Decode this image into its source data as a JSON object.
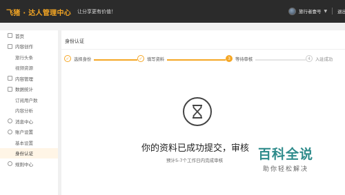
{
  "topbar": {
    "brand": "飞猪 · 达人管理中心",
    "slogan": "让分享更有价值！",
    "user_name": "旅行者壹号",
    "user_caret": "▼",
    "logout": "退出"
  },
  "sidebar": {
    "items": [
      {
        "label": "首页",
        "icon": "home-icon"
      },
      {
        "label": "内容创作",
        "icon": "edit-icon"
      },
      {
        "label": "旅行头条"
      },
      {
        "label": "视频资源"
      },
      {
        "label": "内容管理",
        "icon": "document-icon"
      },
      {
        "label": "数据统计",
        "icon": "chart-icon"
      },
      {
        "label": "订阅用户数"
      },
      {
        "label": "内容分析"
      },
      {
        "label": "消息中心",
        "icon": "message-icon"
      },
      {
        "label": "账户设置",
        "icon": "user-icon"
      },
      {
        "label": "基本设置"
      },
      {
        "label": "身份认证"
      },
      {
        "label": "规则中心",
        "icon": "rules-icon"
      }
    ]
  },
  "main": {
    "title": "身份认证",
    "steps": [
      {
        "num": "✓",
        "label": "选择身份",
        "state": "done"
      },
      {
        "num": "✓",
        "label": "填写资料",
        "state": "done"
      },
      {
        "num": "3",
        "label": "等待审核",
        "state": "current"
      },
      {
        "num": "4",
        "label": "入驻成功",
        "state": "todo"
      }
    ],
    "message": "你的资料已成功提交，审核",
    "sub_message": "预计5-7个工作日内完成审核"
  },
  "watermark": {
    "title": "百科全说",
    "subtitle": "助你轻松解决"
  },
  "colors": {
    "accent": "#f5a623",
    "topbar_bg": "#2b2b2b",
    "active_bg": "#fff5e6",
    "watermark": "#2e8b8b"
  }
}
